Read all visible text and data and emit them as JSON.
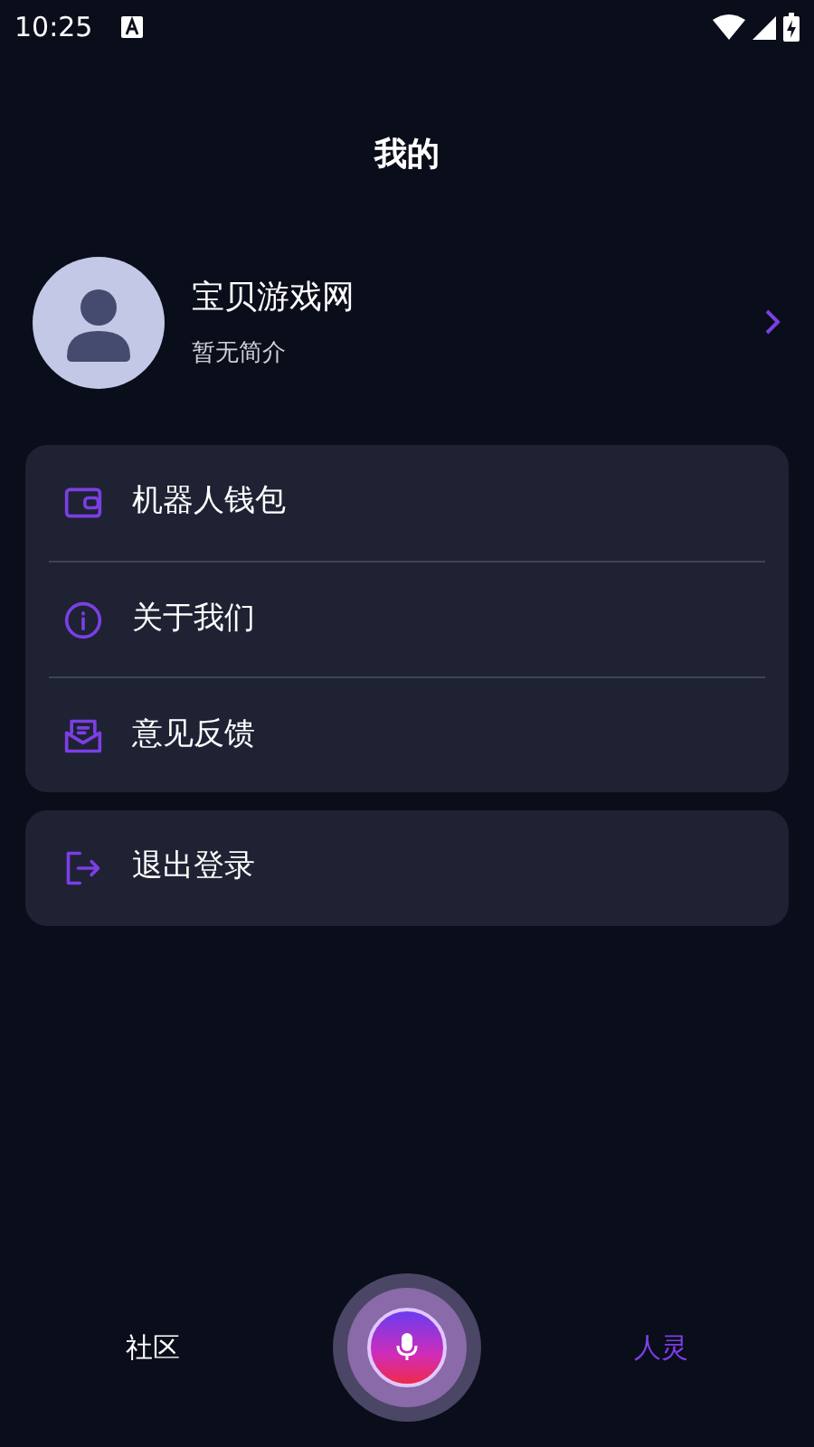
{
  "status_bar": {
    "time": "10:25"
  },
  "header": {
    "title": "我的"
  },
  "profile": {
    "name": "宝贝游戏网",
    "bio": "暂无简介"
  },
  "menu_groups": [
    {
      "items": [
        {
          "label": "机器人钱包",
          "kind": "wallet"
        },
        {
          "label": "关于我们",
          "kind": "info"
        },
        {
          "label": "意见反馈",
          "kind": "feedback"
        }
      ]
    },
    {
      "items": [
        {
          "label": "退出登录",
          "kind": "logout"
        }
      ]
    }
  ],
  "bottom_nav": [
    {
      "label": "社区",
      "selected": false
    },
    {
      "label": "人灵",
      "selected": true
    }
  ]
}
